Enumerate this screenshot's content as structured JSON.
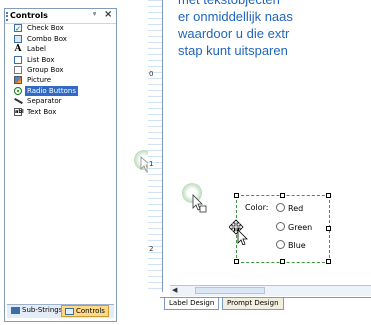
{
  "controls_panel": {
    "title": "Controls",
    "items": [
      {
        "label": "Check Box",
        "icon": "checkbox-icon"
      },
      {
        "label": "Combo Box",
        "icon": "combobox-icon"
      },
      {
        "label": "Label",
        "icon": "label-icon"
      },
      {
        "label": "List Box",
        "icon": "listbox-icon"
      },
      {
        "label": "Group Box",
        "icon": "groupbox-icon"
      },
      {
        "label": "Picture",
        "icon": "picture-icon"
      },
      {
        "label": "Radio Buttons",
        "icon": "radio-icon",
        "selected": true
      },
      {
        "label": "Separator",
        "icon": "separator-icon"
      },
      {
        "label": "Text Box",
        "icon": "textbox-icon"
      }
    ],
    "bottom_tabs": [
      {
        "label": "Sub-Strings"
      },
      {
        "label": "Controls",
        "active": true
      }
    ]
  },
  "document_text": {
    "line1": "met tekstobjecten",
    "line2": "er onmiddellijk naas",
    "line3": "waardoor u die extr",
    "line4": "stap kunt uitsparen"
  },
  "ruler": {
    "numbers": [
      "0",
      "1",
      "2"
    ]
  },
  "design_object": {
    "label": "Color:",
    "options": [
      "Red",
      "Green",
      "Blue"
    ]
  },
  "design_tabs": [
    {
      "label": "Label Design",
      "active": true
    },
    {
      "label": "Prompt Design",
      "active": false
    }
  ],
  "colors": {
    "accent": "#316ac5",
    "selection_border": "#3a9a3a",
    "doc_text": "#2266bb"
  }
}
